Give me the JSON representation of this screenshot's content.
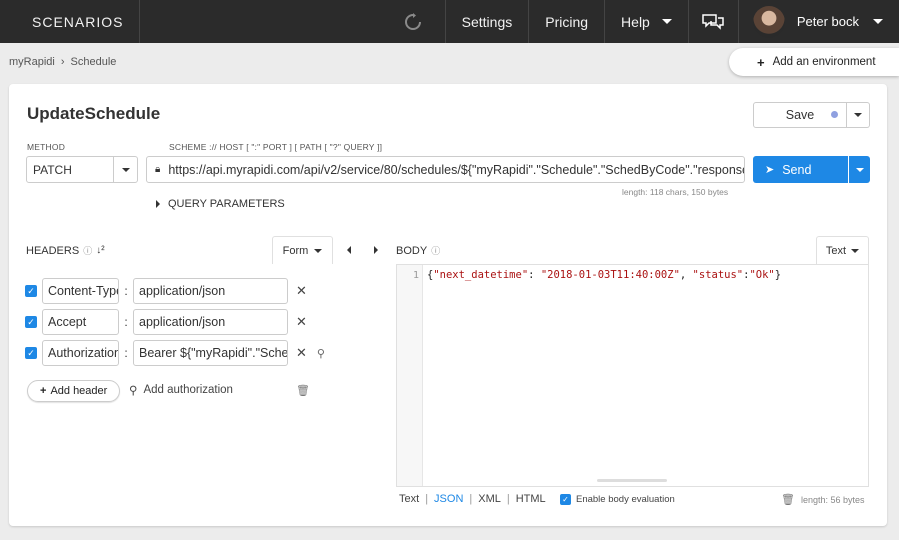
{
  "topbar": {
    "brand": "SCENARIOS",
    "nav": [
      "Settings",
      "Pricing",
      "Help"
    ],
    "user_name": "Peter bock"
  },
  "breadcrumb": [
    "myRapidi",
    "Schedule"
  ],
  "add_environment": "Add an environment",
  "request": {
    "title": "UpdateSchedule",
    "save_label": "Save",
    "method_label": "METHOD",
    "method": "PATCH",
    "url_label": "SCHEME :// HOST [ \":\" PORT ] [ PATH [ \"?\" QUERY ]]",
    "url": "https://api.myrapidi.com/api/v2/service/80/schedules/${\"myRapidi\".\"Schedule\".\"SchedByCode\".\"response\"",
    "url_length": "length: 118 chars, 150 bytes",
    "send_label": "Send",
    "query_parameters": "QUERY PARAMETERS"
  },
  "headers": {
    "label": "HEADERS",
    "form_label": "Form",
    "rows": [
      {
        "key": "Content-Type",
        "value": "application/json"
      },
      {
        "key": "Accept",
        "value": "application/json"
      },
      {
        "key": "Authorization",
        "value": "Bearer ${\"myRapidi\".\"Schedule\"}"
      }
    ],
    "add_header": "Add header",
    "add_authorization": "Add authorization"
  },
  "body": {
    "label": "BODY",
    "text_label": "Text",
    "line_number": "1",
    "code_open": "{",
    "k1": "\"next_datetime\"",
    "c1": ": ",
    "v1": "\"2018-01-03T11:40:00Z\"",
    "c2": ", ",
    "k2": "\"status\"",
    "c3": ":",
    "v2": "\"Ok\"",
    "code_close": "}",
    "formats": [
      "Text",
      "JSON",
      "XML",
      "HTML"
    ],
    "active_format": "JSON",
    "enable_eval": "Enable body evaluation",
    "length": "length: 56 bytes"
  }
}
